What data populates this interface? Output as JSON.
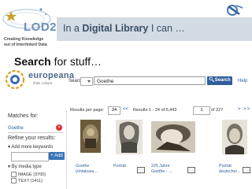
{
  "slide": {
    "title_prefix": "In a ",
    "title_bold": "Digital Library",
    "title_suffix": " I can …",
    "logo_text": "LOD2",
    "logo_tagline_1": "Creating Knowledge",
    "logo_tagline_2": "out of Interlinked Data",
    "heading_bold": "Search",
    "heading_rest": " for stuff…"
  },
  "europeana": {
    "logo_name": "europeana",
    "logo_sub": "think culture",
    "search_label": "Search",
    "search_value": "Goethe",
    "search_button": "Search",
    "help_link": "Help"
  },
  "sidebar": {
    "matches_heading": "Matches for:",
    "match_term": "Goethe",
    "refine_heading": "Refine your results:",
    "add_keywords": "Add more keywords",
    "add_button": "+ Add",
    "by_media_type": "By media type",
    "media_options": [
      {
        "label": "IMAGE (3700)"
      },
      {
        "label": "TEXT (1411)"
      }
    ]
  },
  "results": {
    "per_page_label": "Results per page:",
    "per_page_value": "24",
    "range": "Results 1 - 24 of 5,443",
    "page_value": "1",
    "page_total": "of 227",
    "next_nav": "> >>",
    "first_nav": "<<",
    "items": [
      {
        "title": "Goethe (rintakuva..."
      },
      {
        "title": "Porträt"
      },
      {
        "title": "225 Jahre Goethe - ..."
      },
      {
        "title": "Porträt deutscher..."
      }
    ]
  },
  "colors": {
    "header_bar": "#d3dbe4",
    "link_blue": "#2f5e9b",
    "search_button": "#2f5e9b"
  }
}
